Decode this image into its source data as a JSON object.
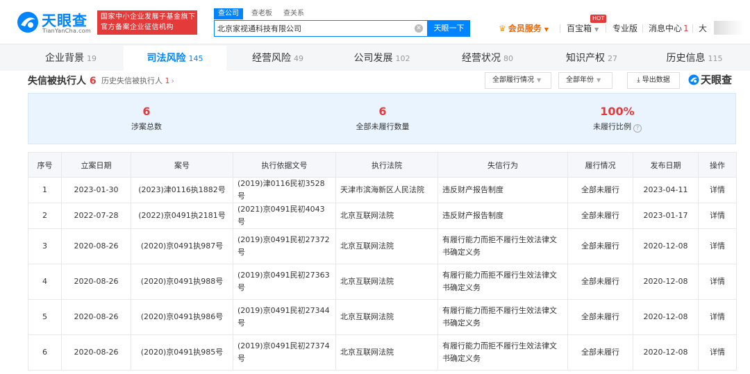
{
  "header": {
    "logo_text": "天眼查",
    "logo_sub": "TianYanCha.com",
    "slogan_line1": "国家中小企业发展子基金旗下",
    "slogan_line2": "官方备案企业征信机构",
    "search_tabs": [
      "查公司",
      "查老板",
      "查关系"
    ],
    "search_value": "北京家视通科技有限公司",
    "search_button": "天眼一下",
    "nav": {
      "vip": "会员服务",
      "baibaoxiang": "百宝箱",
      "hot": "HOT",
      "pro": "专业版",
      "messages": "消息中心",
      "message_count": "1",
      "user": "大"
    }
  },
  "tabs": [
    {
      "label": "企业背景",
      "count": "19"
    },
    {
      "label": "司法风险",
      "count": "145"
    },
    {
      "label": "经营风险",
      "count": "49"
    },
    {
      "label": "公司发展",
      "count": "102"
    },
    {
      "label": "经营状况",
      "count": "80"
    },
    {
      "label": "知识产权",
      "count": "27"
    },
    {
      "label": "历史信息",
      "count": "115"
    }
  ],
  "section": {
    "title": "失信被执行人",
    "count": "6",
    "history_label": "历史失信被执行人",
    "history_count": "1",
    "filter_status": "全部履行情况",
    "filter_year": "全部年份",
    "export": "导出数据",
    "watermark": "天眼查"
  },
  "stats": [
    {
      "value": "6",
      "label": "涉案总数"
    },
    {
      "value": "6",
      "label": "全部未履行数量"
    },
    {
      "value": "100%",
      "label": "未履行比例"
    }
  ],
  "table": {
    "headers": [
      "序号",
      "立案日期",
      "案号",
      "执行依据文号",
      "执行法院",
      "失信行为",
      "履行情况",
      "发布日期",
      "操作"
    ],
    "rows": [
      [
        "1",
        "2023-01-30",
        "(2023)津0116执1882号",
        "(2019)津0116民初3528号",
        "天津市滨海新区人民法院",
        "违反财产报告制度",
        "全部未履行",
        "2023-04-11",
        "详情"
      ],
      [
        "2",
        "2022-07-28",
        "(2022)京0491执2181号",
        "(2021)京0491民初4043号",
        "北京互联网法院",
        "违反财产报告制度",
        "全部未履行",
        "2023-01-17",
        "详情"
      ],
      [
        "3",
        "2020-08-26",
        "(2020)京0491执987号",
        "(2019)京0491民初27372号",
        "北京互联网法院",
        "有履行能力而拒不履行生效法律文书确定义务",
        "全部未履行",
        "2020-12-08",
        "详情"
      ],
      [
        "4",
        "2020-08-26",
        "(2020)京0491执988号",
        "(2019)京0491民初27363号",
        "北京互联网法院",
        "有履行能力而拒不履行生效法律文书确定义务",
        "全部未履行",
        "2020-12-08",
        "详情"
      ],
      [
        "5",
        "2020-08-26",
        "(2020)京0491执986号",
        "(2019)京0491民初27344号",
        "北京互联网法院",
        "有履行能力而拒不履行生效法律文书确定义务",
        "全部未履行",
        "2020-12-08",
        "详情"
      ],
      [
        "6",
        "2020-08-26",
        "(2020)京0491执985号",
        "(2019)京0491民初27374号",
        "北京互联网法院",
        "有履行能力而拒不履行生效法律文书确定义务",
        "全部未履行",
        "2020-12-08",
        "详情"
      ]
    ]
  },
  "colors": {
    "brand_blue": "#0084ff",
    "alert_red": "#e43a3a",
    "vip_orange": "#f06400"
  }
}
